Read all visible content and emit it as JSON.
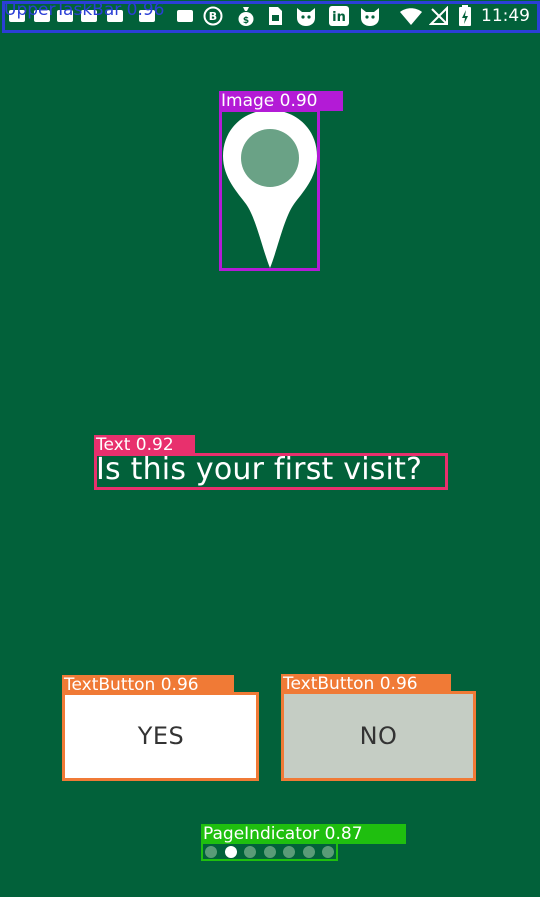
{
  "status_bar": {
    "time": "11:49",
    "icons": [
      "image-icon",
      "image-icon",
      "image-icon",
      "image-icon",
      "image-icon",
      "image-icon",
      "bitcoin-icon",
      "money-bag-icon",
      "sim-icon",
      "cat-icon",
      "linkedin-icon",
      "cat-icon",
      "wifi-icon",
      "no-signal-icon",
      "battery-charging-icon"
    ],
    "linkedin_text": "in"
  },
  "main": {
    "question": "Is this your first visit?",
    "yes_label": "YES",
    "no_label": "NO",
    "page_indicator": {
      "total": 7,
      "active_index": 1
    }
  },
  "detections": {
    "status_bar": {
      "label": "UpperTaskBar 0.96",
      "color": "#2b3fd6"
    },
    "image": {
      "label": "Image 0.90",
      "color": "#b31bd6"
    },
    "text": {
      "label": "Text 0.92",
      "color": "#e8306d"
    },
    "yes_button": {
      "label": "TextButton 0.96",
      "color": "#f07a36"
    },
    "no_button": {
      "label": "TextButton 0.96",
      "color": "#f07a36"
    },
    "page_indicator": {
      "label": "PageIndicator 0.87",
      "color": "#1fbf0f"
    }
  },
  "colors": {
    "background": "#02613a",
    "pin": "#ffffff",
    "pin_center": "#6aa286",
    "button_yes": "#ffffff",
    "button_no": "#c5cdc4",
    "dot_inactive": "#5a9b77",
    "dot_active": "#ffffff"
  }
}
